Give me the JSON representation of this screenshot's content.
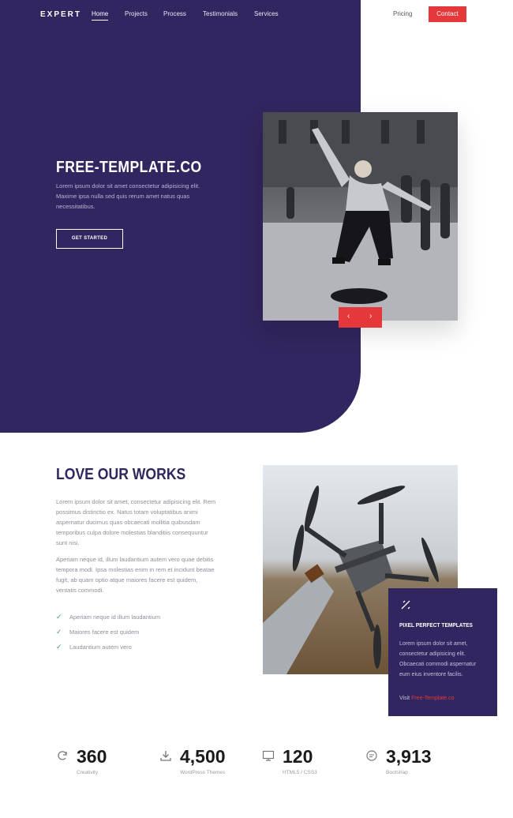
{
  "colors": {
    "primary": "#31265f",
    "accent": "#e5383b",
    "check": "#3aa07f"
  },
  "nav": {
    "logo": "EXPERT",
    "links": [
      "Home",
      "Projects",
      "Process",
      "Testimonials",
      "Services"
    ],
    "active": "Home",
    "pricing": "Pricing",
    "contact": "Contact"
  },
  "hero": {
    "title": "FREE-TEMPLATE.CO",
    "text": "Lorem ipsum dolor sit amet consectetur adipisicing elit. Maxime ipsa nulla sed quis rerum amet natus quas necessitatibus.",
    "button": "GET STARTED",
    "prev": "‹",
    "next": "›"
  },
  "works": {
    "title": "LOVE OUR WORKS",
    "para1": "Lorem ipsum dolor sit amet, consectetur adipisicing elit. Rem possimus distinctio ex. Natus totam voluptatibus animi aspernatur ducimus quas obcaecati mollitia quibusdam temporibus culpa dolore molestias blanditiis consequuntur sunt nisi.",
    "para2": "Aperiam neque id, illum laudantium autem vero quae debitis tempora modi. Ipsa molestias enim in rem et incidunt beatae fugit, ab quam optio atque maiores facere est quidem, ventatis commodi.",
    "list": [
      "Aperiam neque id illum laudantium",
      "Maiores facere est quidem",
      "Laudantium autem vero"
    ]
  },
  "card": {
    "icon": "ruler-icon",
    "title": "PIXEL PERFECT TEMPLATES",
    "text": "Lorem ipsum dolor sit amet, consectetur adipisicing elit. Obcaecati commodi aspernatur eum eius inventore facilis.",
    "visit_label": "Visit",
    "visit_link": "Free-Template.co"
  },
  "stats": [
    {
      "icon": "refresh-icon",
      "value": "360",
      "label": "Creativity"
    },
    {
      "icon": "download-icon",
      "value": "4,500",
      "label": "WordPress Themes"
    },
    {
      "icon": "monitor-icon",
      "value": "120",
      "label": "HTML5 / CSS3"
    },
    {
      "icon": "chat-icon",
      "value": "3,913",
      "label": "Bootstrap"
    }
  ]
}
